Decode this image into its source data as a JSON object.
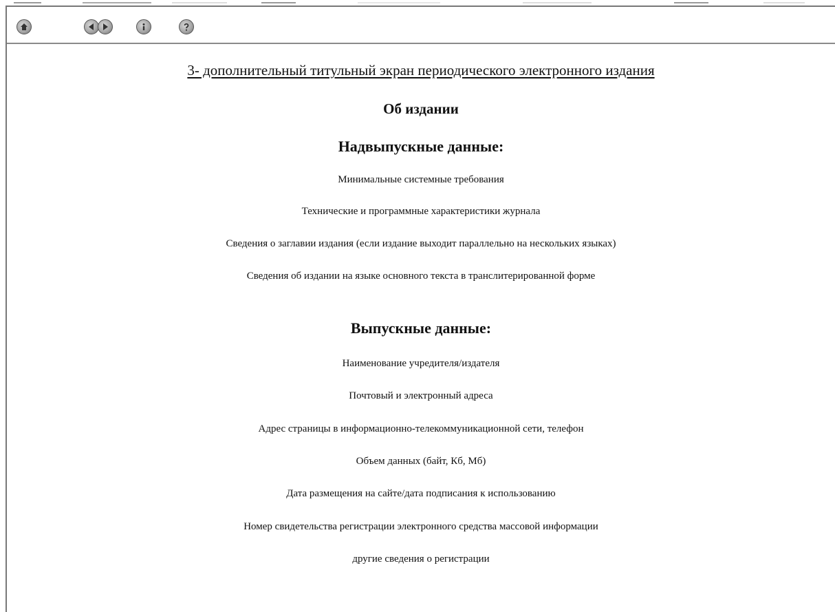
{
  "toolbar": {
    "buttons": [
      {
        "name": "home-icon"
      },
      {
        "name": "back-icon"
      },
      {
        "name": "forward-icon"
      },
      {
        "name": "info-icon"
      },
      {
        "name": "help-icon"
      }
    ]
  },
  "page": {
    "title": "3- дополнительный титульный экран периодического электронного издания",
    "heading": "Об издании",
    "section1": {
      "heading": "Надвыпускные данные:",
      "items": [
        "Минимальные системные требования",
        "Технические и программные характеристики журнала",
        "Сведения о заглавии издания (если издание выходит параллельно на нескольких языках)",
        "Сведения об издании на языке основного текста в транслитерированной форме"
      ]
    },
    "section2": {
      "heading": "Выпускные данные:",
      "items": [
        "Наименование учредителя/издателя",
        "Почтовый и электронный адреса",
        "Адрес страницы в информационно-телекоммуникационной сети, телефон",
        "Объем данных (байт, Кб, Мб)",
        "Дата размещения на сайте/дата подписания к использованию",
        "Номер свидетельства регистрации электронного средства массовой информации",
        "другие сведения о регистрации"
      ]
    }
  }
}
